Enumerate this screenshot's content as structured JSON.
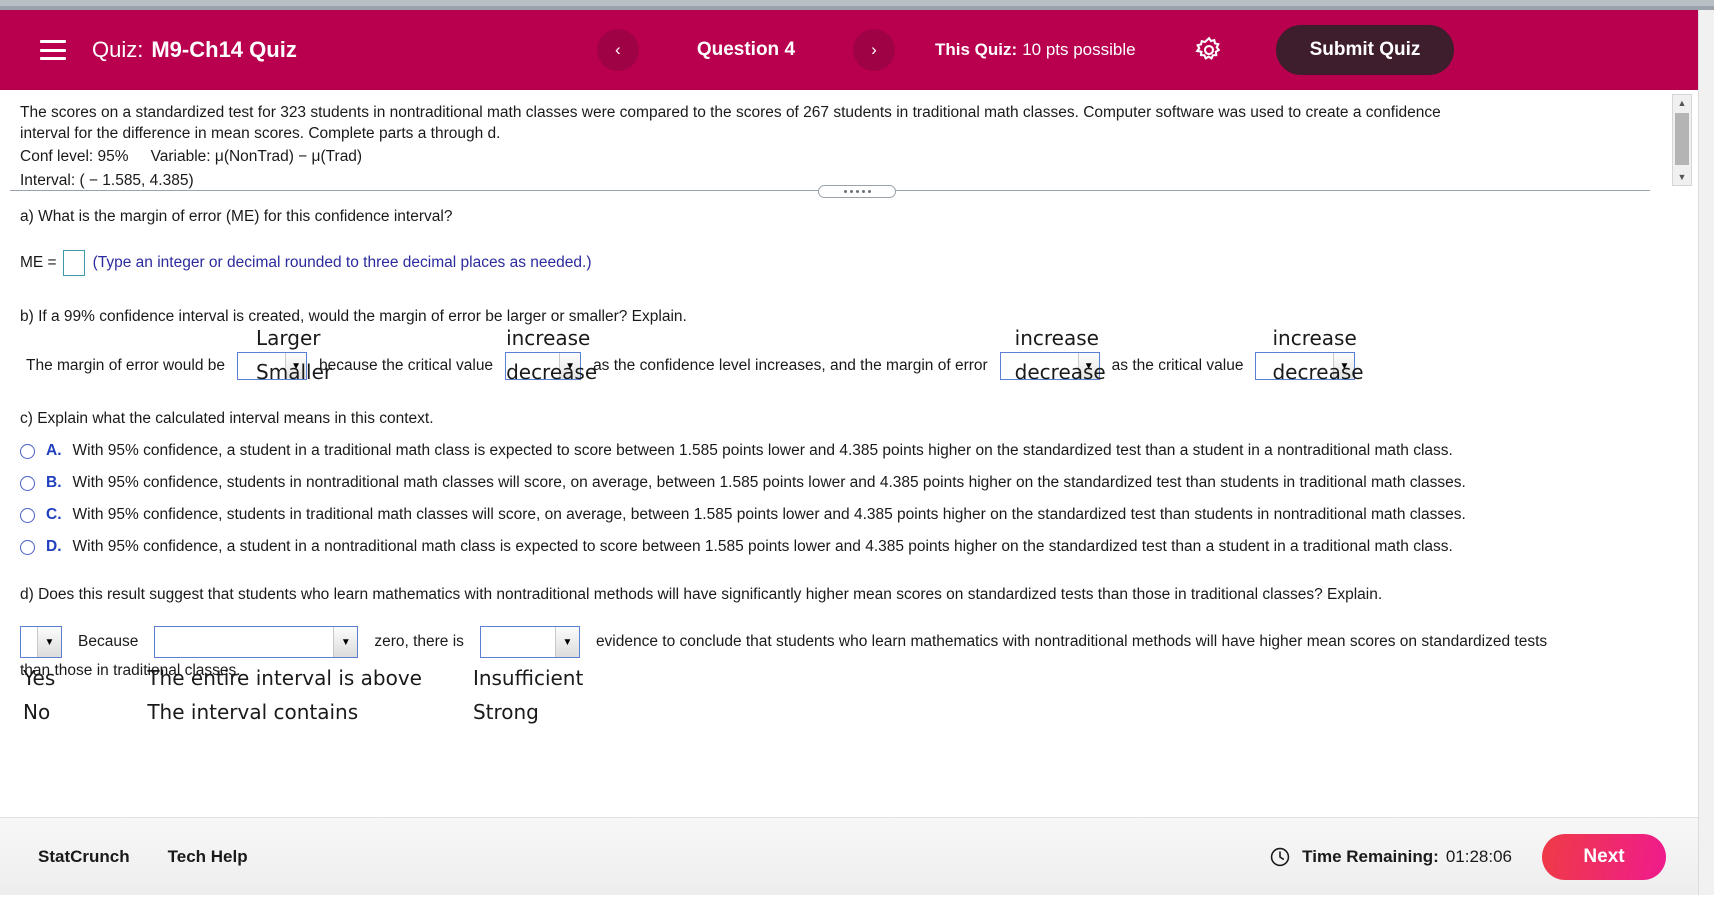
{
  "header": {
    "menu_icon": "hamburger-icon",
    "quiz_label": "Quiz:",
    "quiz_name": "M9-Ch14 Quiz",
    "prev_arrow": "‹",
    "question_label": "Question 4",
    "next_arrow": "›",
    "points_label": "This Quiz:",
    "points_value": "10 pts possible",
    "settings_icon": "gear-icon",
    "submit_label": "Submit Quiz",
    "bg_color": "#b8004f",
    "submit_bg_color": "#3e1d2c"
  },
  "stem": {
    "line1": "The scores on a standardized test for 323 students in nontraditional math classes were compared to the scores of 267 students in traditional math classes. Computer software was used to create a confidence",
    "line2": "interval for the difference in mean scores. Complete parts a through d.",
    "conf_level": "Conf level: 95%",
    "variable": "Variable: μ(NonTrad) − μ(Trad)",
    "interval": "Interval: ( − 1.585, 4.385)"
  },
  "part_a": {
    "prompt": "a) What is the margin of error (ME) for this confidence interval?",
    "me_label": "ME =",
    "me_value": "",
    "hint": "(Type an integer or decimal rounded to three decimal places as needed.)",
    "hint_color": "#2b2b9e",
    "input_border_color": "#3d9aa8"
  },
  "part_b": {
    "prompt": "b) If a 99% confidence interval is created, would the margin of error be larger or smaller? Explain.",
    "sentence_1": "The margin of error would be",
    "sentence_2": "because the critical value",
    "sentence_3": "as the confidence level increases, and the margin of error",
    "sentence_4": "as the critical value",
    "dropdown_1": {
      "value": "",
      "options": [
        "Larger",
        "Smaller"
      ]
    },
    "dropdown_2": {
      "value": "",
      "options": [
        "increase",
        "decrease"
      ]
    },
    "dropdown_3": {
      "value": "",
      "options": [
        "increase",
        "decrease"
      ]
    },
    "dropdown_4": {
      "value": "",
      "options": [
        "increase",
        "decrease"
      ]
    }
  },
  "part_c": {
    "prompt": "c) Explain what the calculated interval means in this context.",
    "choices": [
      {
        "letter": "A.",
        "text": "With 95% confidence, a student in a traditional math class is expected to score between 1.585 points lower and 4.385 points higher on the standardized test than a student in a nontraditional math class.",
        "selected": false
      },
      {
        "letter": "B.",
        "text": "With 95% confidence, students in nontraditional math classes will score, on average, between 1.585 points lower and 4.385 points higher on the standardized test than students in traditional math classes.",
        "selected": false
      },
      {
        "letter": "C.",
        "text": "With 95% confidence, students in traditional math classes will score, on average, between 1.585 points lower and 4.385 points higher on the standardized test than students in nontraditional math classes.",
        "selected": false
      },
      {
        "letter": "D.",
        "text": "With 95% confidence, a student in a nontraditional math class is expected to score between 1.585 points lower and 4.385 points higher on the standardized test than a student in a traditional math class.",
        "selected": false
      }
    ]
  },
  "part_d": {
    "prompt": "d) Does this result suggest that students who learn mathematics with nontraditional methods will have significantly higher mean scores on standardized tests than those in traditional classes? Explain.",
    "sentence_1": "Because",
    "sentence_2": "zero, there is",
    "sentence_3": "evidence to conclude that students who learn mathematics with nontraditional methods will have higher mean scores on standardized tests",
    "sentence_4": "than those in traditional classes.",
    "dropdown_1": {
      "value": "",
      "options": [
        "Yes",
        "No"
      ]
    },
    "dropdown_2": {
      "value": "",
      "options": [
        "The entire interval is above",
        "The interval contains"
      ]
    },
    "dropdown_3": {
      "value": "",
      "options": [
        "Insufficient",
        "Strong"
      ]
    }
  },
  "footer": {
    "statcrunch_label": "StatCrunch",
    "techhelp_label": "Tech Help",
    "clock_icon": "clock-icon",
    "time_label": "Time Remaining:",
    "time_value": "01:28:06",
    "next_label": "Next",
    "next_gradient_start": "#ef3b46",
    "next_gradient_end": "#ef1b8d"
  },
  "scrollbars": {
    "stem_up_arrow": "▲",
    "stem_down_arrow": "▼",
    "page_down_arrow": "▼"
  }
}
